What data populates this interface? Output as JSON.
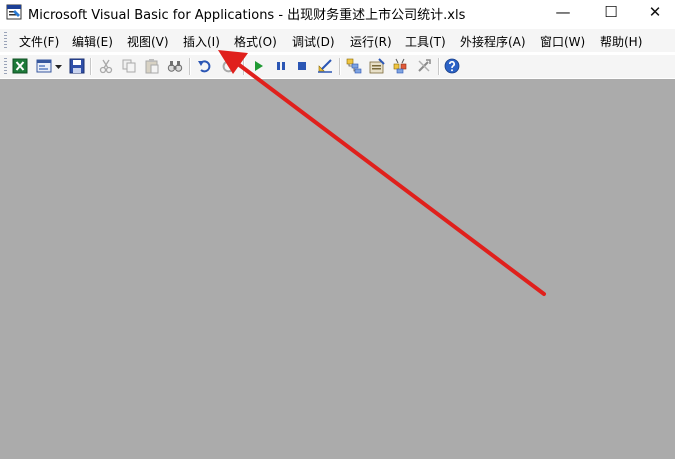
{
  "window": {
    "title": "Microsoft Visual Basic for Applications - 出现财务重述上市公司统计.xls",
    "minimize_glyph": "—",
    "maximize_glyph": "☐",
    "close_glyph": "✕"
  },
  "menu": {
    "items": [
      {
        "label": "文件(F)"
      },
      {
        "label": "编辑(E)"
      },
      {
        "label": "视图(V)"
      },
      {
        "label": "插入(I)"
      },
      {
        "label": "格式(O)"
      },
      {
        "label": "调试(D)"
      },
      {
        "label": "运行(R)"
      },
      {
        "label": "工具(T)"
      },
      {
        "label": "外接程序(A)"
      },
      {
        "label": "窗口(W)"
      },
      {
        "label": "帮助(H)"
      }
    ]
  },
  "toolbar": {
    "icons": [
      "excel-icon",
      "insert-userform-icon",
      "dropdown-arrow-icon",
      "save-icon",
      "cut-icon",
      "copy-icon",
      "paste-icon",
      "find-icon",
      "undo-icon",
      "redo-icon",
      "run-icon",
      "break-icon",
      "reset-icon",
      "design-mode-icon",
      "project-explorer-icon",
      "properties-window-icon",
      "object-browser-icon",
      "toolbox-icon",
      "help-icon"
    ]
  },
  "colors": {
    "workspace": "#ababab",
    "annotation_arrow": "#e0201c"
  }
}
